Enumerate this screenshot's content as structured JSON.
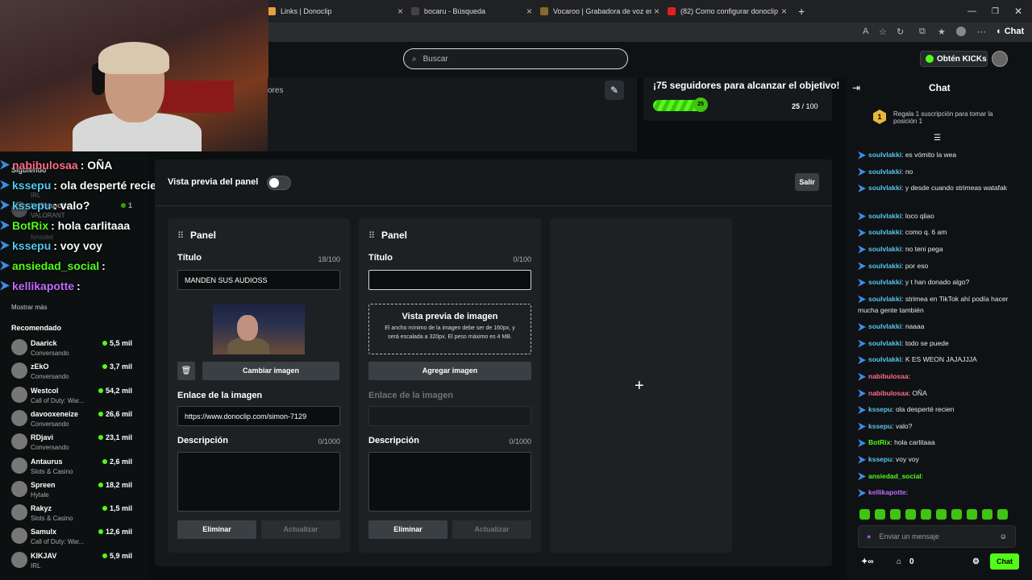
{
  "browser": {
    "tabs": [
      {
        "label": "Links | Donoclip",
        "color": "#e8a13a"
      },
      {
        "label": "bocaru - Búsqueda",
        "color": "#444"
      },
      {
        "label": "Vocaroo | Grabadora de voz en lín",
        "color": "#8a6a2a"
      },
      {
        "label": "(82) Como configurar donoclip - Yo",
        "color": "#e02020"
      }
    ],
    "toolbar_chat_label": "Chat"
  },
  "header": {
    "search_placeholder": "Buscar",
    "kicks_label": "Obtén KICKs"
  },
  "stream_info": {
    "partial_text": "ores",
    "goal_title": "¡75 seguidores para alcanzar el objetivo!",
    "goal_count": "25",
    "goal_total": "/ 100",
    "goal_progress": 0.25,
    "goal_badge": "25"
  },
  "overlay_chat": [
    {
      "user": "nabibulosaa",
      "color": "#ff6b8a",
      "text": ": OÑA"
    },
    {
      "user": "kssepu",
      "color": "#53c8f0",
      "text": ": ola desperté recien"
    },
    {
      "user": "kssepu",
      "color": "#53c8f0",
      "text": ": valo?"
    },
    {
      "user": "BotRix",
      "color": "#53fc18",
      "text": ": hola carlitaaa"
    },
    {
      "user": "kssepu",
      "color": "#53c8f0",
      "text": ": voy voy"
    },
    {
      "user": "ansiedad_social",
      "color": "#53fc18",
      "text": ":"
    },
    {
      "user": "kellikapotte",
      "color": "#c26bff",
      "text": ":"
    }
  ],
  "sidebar": {
    "following_label": "Siguiendo",
    "followed": [
      {
        "name": "IRL",
        "category": ""
      },
      {
        "name": "kellikapotte",
        "category": "VALORANT",
        "viewers": "1"
      },
      {
        "name": "fonsolet",
        "category": ""
      }
    ],
    "show_more": "Mostrar más",
    "recommended_label": "Recomendado",
    "recommended": [
      {
        "name": "Daarick",
        "category": "Conversando",
        "viewers": "5,5 mil"
      },
      {
        "name": "zEkO",
        "category": "Conversando",
        "viewers": "3,7 mil"
      },
      {
        "name": "Westcol",
        "category": "Call of Duty: War...",
        "viewers": "54,2 mil"
      },
      {
        "name": "davooxeneize",
        "category": "Conversando",
        "viewers": "26,6 mil"
      },
      {
        "name": "RDjavi",
        "category": "Conversando",
        "viewers": "23,1 mil"
      },
      {
        "name": "Antaurus",
        "category": "Slots & Casino",
        "viewers": "2,6 mil"
      },
      {
        "name": "Spreen",
        "category": "Hytale",
        "viewers": "18,2 mil"
      },
      {
        "name": "Rakyz",
        "category": "Slots & Casino",
        "viewers": "1,5 mil"
      },
      {
        "name": "Samulx",
        "category": "Call of Duty: War...",
        "viewers": "12,6 mil"
      },
      {
        "name": "KIKJAV",
        "category": "IRL",
        "viewers": "5,9 mil"
      }
    ]
  },
  "editor": {
    "preview_label": "Vista previa del panel",
    "exit_label": "Salir",
    "panels": [
      {
        "heading": "Panel",
        "title_label": "Título",
        "title_count": "18/100",
        "title_value": "MANDEN SUS AUDIOSS",
        "change_image": "Cambiar imagen",
        "link_label": "Enlace de la imagen",
        "link_value": "https://www.donoclip.com/simon-7129",
        "desc_label": "Descripción",
        "desc_count": "0/1000",
        "delete_label": "Eliminar",
        "update_label": "Actualizar"
      },
      {
        "heading": "Panel",
        "title_label": "Título",
        "title_count": "0/100",
        "title_value": "",
        "drop_title": "Vista previa de imagen",
        "drop_hint": "El ancho mínimo de la imagen debe ser de 160px, y será escalada a 320px. El peso máximo es 4 MB.",
        "add_image": "Agregar imagen",
        "link_label": "Enlace de la imagen",
        "desc_label": "Descripción",
        "desc_count": "0/1000",
        "delete_label": "Eliminar",
        "update_label": "Actualizar"
      }
    ],
    "add_symbol": "+"
  },
  "chat": {
    "title": "Chat",
    "sub_badge": "1",
    "sub_text": "Regala 1 suscripción para tomar la posición 1",
    "messages": [
      {
        "user": "soulvlakki",
        "color": "#53c8f0",
        "text": ": es vómito la wea"
      },
      {
        "user": "soulvlakki",
        "color": "#53c8f0",
        "text": ": no"
      },
      {
        "user": "soulvlakki",
        "color": "#53c8f0",
        "text": ": y desde cuando strimeas watafak"
      },
      {
        "user": "soulvlakki",
        "color": "#53c8f0",
        "text": ": loco qliao"
      },
      {
        "user": "soulvlakki",
        "color": "#53c8f0",
        "text": ": como q. 6 am"
      },
      {
        "user": "soulvlakki",
        "color": "#53c8f0",
        "text": ": no teni pega"
      },
      {
        "user": "soulvlakki",
        "color": "#53c8f0",
        "text": ": por eso"
      },
      {
        "user": "soulvlakki",
        "color": "#53c8f0",
        "text": ": y t han donado algo?"
      },
      {
        "user": "soulvlakki",
        "color": "#53c8f0",
        "text": ": strimea en TikTok ahí podía hacer mucha gente también"
      },
      {
        "user": "soulvlakki",
        "color": "#53c8f0",
        "text": ": naaaa"
      },
      {
        "user": "soulvlakki",
        "color": "#53c8f0",
        "text": ": todo se puede"
      },
      {
        "user": "soulvlakki",
        "color": "#53c8f0",
        "text": ": K ES WEON JAJAJJJA"
      },
      {
        "user": "nabibulosaa",
        "color": "#ff6b8a",
        "text": ":"
      },
      {
        "user": "nabibulosaa",
        "color": "#ff6b8a",
        "text": ": OÑA"
      },
      {
        "user": "kssepu",
        "color": "#53c8f0",
        "text": ": ola desperté recien"
      },
      {
        "user": "kssepu",
        "color": "#53c8f0",
        "text": ": valo?"
      },
      {
        "user": "BotRix",
        "color": "#53fc18",
        "text": ": hola carlitaaa"
      },
      {
        "user": "kssepu",
        "color": "#53c8f0",
        "text": ": voy voy"
      },
      {
        "user": "ansiedad_social",
        "color": "#53fc18",
        "text": ":"
      },
      {
        "user": "kellikapotte",
        "color": "#c26bff",
        "text": ":"
      }
    ],
    "input_placeholder": "Enviar un mensaje",
    "points": "0",
    "send_label": "Chat"
  },
  "accent_color": "#53fc18"
}
